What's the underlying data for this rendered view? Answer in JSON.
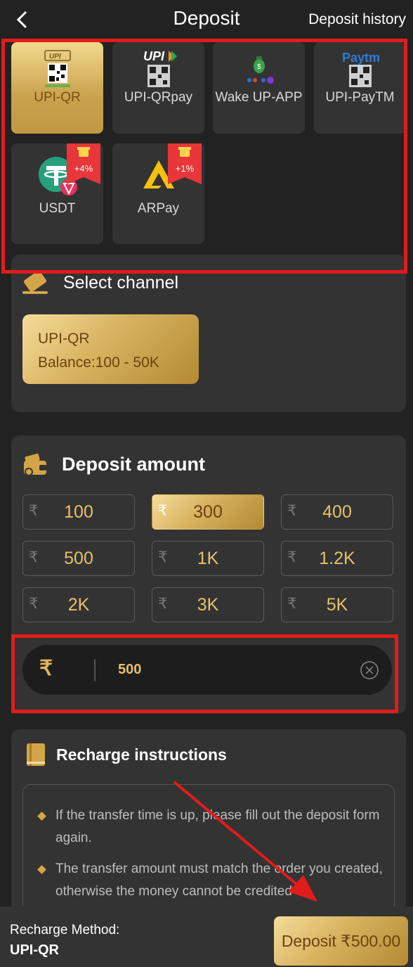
{
  "header": {
    "title": "Deposit",
    "history_link": "Deposit history"
  },
  "methods": [
    {
      "label": "UPI-QR",
      "logo_text": "UPI",
      "active": true
    },
    {
      "label": "UPI-QRpay",
      "logo_text": "UPI",
      "active": false
    },
    {
      "label": "Wake UP-APP",
      "active": false
    },
    {
      "label": "UPI-PayTM",
      "logo_text": "Paytm",
      "active": false
    },
    {
      "label": "USDT",
      "bonus": "+4%",
      "active": false
    },
    {
      "label": "ARPay",
      "bonus": "+1%",
      "active": false
    }
  ],
  "channel": {
    "heading": "Select channel",
    "name": "UPI-QR",
    "balance": "Balance:100 - 50K"
  },
  "amount": {
    "heading": "Deposit amount",
    "currency_symbol": "₹",
    "presets": [
      "100",
      "300",
      "400",
      "500",
      "1K",
      "1.2K",
      "2K",
      "3K",
      "5K"
    ],
    "selected_preset": "300",
    "input_value": "500"
  },
  "instructions": {
    "heading": "Recharge instructions",
    "items": [
      "If the transfer time is up, please fill out the deposit form again.",
      "The transfer amount must match the order you created, otherwise the money cannot be credited"
    ]
  },
  "footer": {
    "method_label": "Recharge Method:",
    "method_value": "UPI-QR",
    "deposit_button": "Deposit ₹500.00"
  },
  "colors": {
    "background": "#222222",
    "card": "#333333",
    "gold": "#d7b25f",
    "highlight_red": "#e21b1b"
  }
}
